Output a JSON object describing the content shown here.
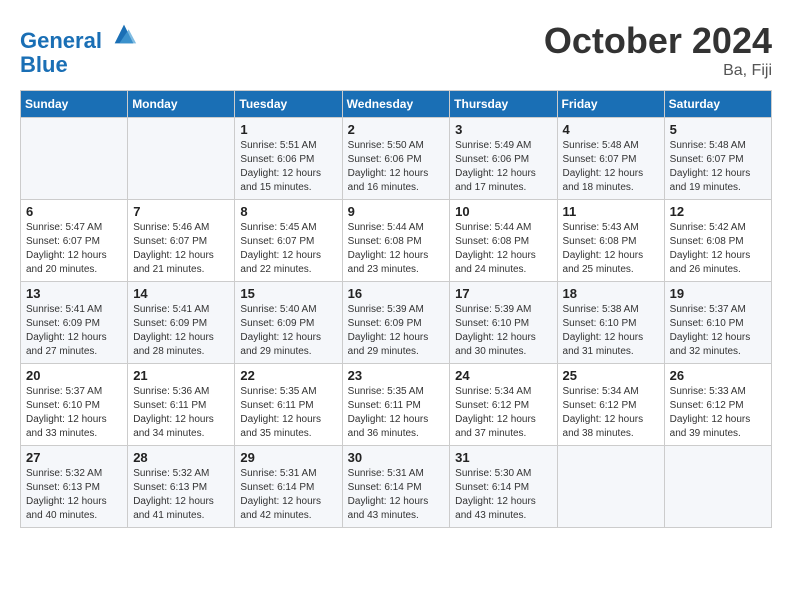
{
  "header": {
    "logo_line1": "General",
    "logo_line2": "Blue",
    "month_title": "October 2024",
    "location": "Ba, Fiji"
  },
  "weekdays": [
    "Sunday",
    "Monday",
    "Tuesday",
    "Wednesday",
    "Thursday",
    "Friday",
    "Saturday"
  ],
  "weeks": [
    [
      {
        "day": "",
        "info": ""
      },
      {
        "day": "",
        "info": ""
      },
      {
        "day": "1",
        "info": "Sunrise: 5:51 AM\nSunset: 6:06 PM\nDaylight: 12 hours and 15 minutes."
      },
      {
        "day": "2",
        "info": "Sunrise: 5:50 AM\nSunset: 6:06 PM\nDaylight: 12 hours and 16 minutes."
      },
      {
        "day": "3",
        "info": "Sunrise: 5:49 AM\nSunset: 6:06 PM\nDaylight: 12 hours and 17 minutes."
      },
      {
        "day": "4",
        "info": "Sunrise: 5:48 AM\nSunset: 6:07 PM\nDaylight: 12 hours and 18 minutes."
      },
      {
        "day": "5",
        "info": "Sunrise: 5:48 AM\nSunset: 6:07 PM\nDaylight: 12 hours and 19 minutes."
      }
    ],
    [
      {
        "day": "6",
        "info": "Sunrise: 5:47 AM\nSunset: 6:07 PM\nDaylight: 12 hours and 20 minutes."
      },
      {
        "day": "7",
        "info": "Sunrise: 5:46 AM\nSunset: 6:07 PM\nDaylight: 12 hours and 21 minutes."
      },
      {
        "day": "8",
        "info": "Sunrise: 5:45 AM\nSunset: 6:07 PM\nDaylight: 12 hours and 22 minutes."
      },
      {
        "day": "9",
        "info": "Sunrise: 5:44 AM\nSunset: 6:08 PM\nDaylight: 12 hours and 23 minutes."
      },
      {
        "day": "10",
        "info": "Sunrise: 5:44 AM\nSunset: 6:08 PM\nDaylight: 12 hours and 24 minutes."
      },
      {
        "day": "11",
        "info": "Sunrise: 5:43 AM\nSunset: 6:08 PM\nDaylight: 12 hours and 25 minutes."
      },
      {
        "day": "12",
        "info": "Sunrise: 5:42 AM\nSunset: 6:08 PM\nDaylight: 12 hours and 26 minutes."
      }
    ],
    [
      {
        "day": "13",
        "info": "Sunrise: 5:41 AM\nSunset: 6:09 PM\nDaylight: 12 hours and 27 minutes."
      },
      {
        "day": "14",
        "info": "Sunrise: 5:41 AM\nSunset: 6:09 PM\nDaylight: 12 hours and 28 minutes."
      },
      {
        "day": "15",
        "info": "Sunrise: 5:40 AM\nSunset: 6:09 PM\nDaylight: 12 hours and 29 minutes."
      },
      {
        "day": "16",
        "info": "Sunrise: 5:39 AM\nSunset: 6:09 PM\nDaylight: 12 hours and 29 minutes."
      },
      {
        "day": "17",
        "info": "Sunrise: 5:39 AM\nSunset: 6:10 PM\nDaylight: 12 hours and 30 minutes."
      },
      {
        "day": "18",
        "info": "Sunrise: 5:38 AM\nSunset: 6:10 PM\nDaylight: 12 hours and 31 minutes."
      },
      {
        "day": "19",
        "info": "Sunrise: 5:37 AM\nSunset: 6:10 PM\nDaylight: 12 hours and 32 minutes."
      }
    ],
    [
      {
        "day": "20",
        "info": "Sunrise: 5:37 AM\nSunset: 6:10 PM\nDaylight: 12 hours and 33 minutes."
      },
      {
        "day": "21",
        "info": "Sunrise: 5:36 AM\nSunset: 6:11 PM\nDaylight: 12 hours and 34 minutes."
      },
      {
        "day": "22",
        "info": "Sunrise: 5:35 AM\nSunset: 6:11 PM\nDaylight: 12 hours and 35 minutes."
      },
      {
        "day": "23",
        "info": "Sunrise: 5:35 AM\nSunset: 6:11 PM\nDaylight: 12 hours and 36 minutes."
      },
      {
        "day": "24",
        "info": "Sunrise: 5:34 AM\nSunset: 6:12 PM\nDaylight: 12 hours and 37 minutes."
      },
      {
        "day": "25",
        "info": "Sunrise: 5:34 AM\nSunset: 6:12 PM\nDaylight: 12 hours and 38 minutes."
      },
      {
        "day": "26",
        "info": "Sunrise: 5:33 AM\nSunset: 6:12 PM\nDaylight: 12 hours and 39 minutes."
      }
    ],
    [
      {
        "day": "27",
        "info": "Sunrise: 5:32 AM\nSunset: 6:13 PM\nDaylight: 12 hours and 40 minutes."
      },
      {
        "day": "28",
        "info": "Sunrise: 5:32 AM\nSunset: 6:13 PM\nDaylight: 12 hours and 41 minutes."
      },
      {
        "day": "29",
        "info": "Sunrise: 5:31 AM\nSunset: 6:14 PM\nDaylight: 12 hours and 42 minutes."
      },
      {
        "day": "30",
        "info": "Sunrise: 5:31 AM\nSunset: 6:14 PM\nDaylight: 12 hours and 43 minutes."
      },
      {
        "day": "31",
        "info": "Sunrise: 5:30 AM\nSunset: 6:14 PM\nDaylight: 12 hours and 43 minutes."
      },
      {
        "day": "",
        "info": ""
      },
      {
        "day": "",
        "info": ""
      }
    ]
  ]
}
